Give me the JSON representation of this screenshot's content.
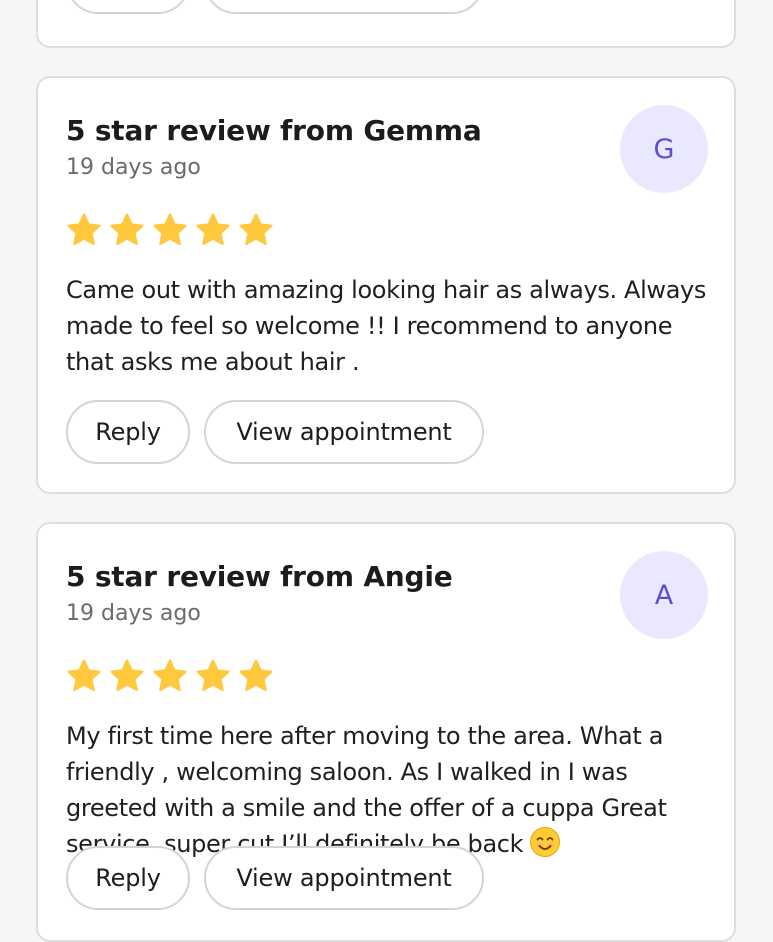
{
  "actions": {
    "reply_label": "Reply",
    "view_label": "View appointment"
  },
  "reviews": [
    {
      "title": "5 star review from Gemma",
      "time": "19 days ago",
      "initial": "G",
      "rating": 5,
      "text": "Came out with amazing looking hair as always. Always made to feel so welcome !! I recommend to anyone that asks me about hair ."
    },
    {
      "title": "5 star review from Angie",
      "time": "19 days ago",
      "initial": "A",
      "rating": 5,
      "text": "My first time here after moving to the area. What a friendly , welcoming saloon. As I walked in I was greeted with a smile and the offer of a cuppa Great service, super cut I’ll definitely be back"
    }
  ],
  "icons": {
    "star": "star-icon",
    "emoji": "smiling-face-icon"
  },
  "colors": {
    "background": "#f6f6f6",
    "card_border": "#dedede",
    "avatar_bg": "#eae8ff",
    "avatar_text": "#5b4fd0",
    "star": "#ffc83d"
  }
}
